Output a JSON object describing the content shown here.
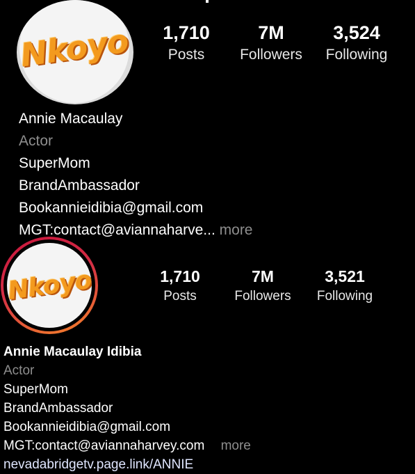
{
  "profile_top": {
    "logo_text": "Nkoyo",
    "stats": [
      {
        "value": "1,710",
        "label": "Posts"
      },
      {
        "value": "7M",
        "label": "Followers"
      },
      {
        "value": "3,524",
        "label": "Following"
      }
    ],
    "name": "Annie Macaulay",
    "category": "Actor",
    "bio_lines": [
      "SuperMom",
      "BrandAmbassador",
      "Bookannieidibia@gmail.com"
    ],
    "truncated_line": "MGT:contact@aviannaharve...",
    "more_label": "more"
  },
  "profile_bottom": {
    "logo_text": "Nkoyo",
    "stats": [
      {
        "value": "1,710",
        "label": "Posts"
      },
      {
        "value": "7M",
        "label": "Followers"
      },
      {
        "value": "3,521",
        "label": "Following"
      }
    ],
    "name": "Annie Macaulay Idibia",
    "category": "Actor",
    "bio_lines": [
      "SuperMom",
      "BrandAmbassador",
      "Bookannieidibia@gmail.com"
    ],
    "mgt_line": "MGT:contact@aviannaharvey.com",
    "more_label": "more",
    "link": "nevadabridgetv.page.link/ANNIE"
  },
  "colors": {
    "background": "#000000",
    "text": "#ffffff",
    "muted": "#8e8e8e",
    "logo": "#f39a1e",
    "story_ring_start": "#f58529",
    "story_ring_end": "#c8143c"
  }
}
